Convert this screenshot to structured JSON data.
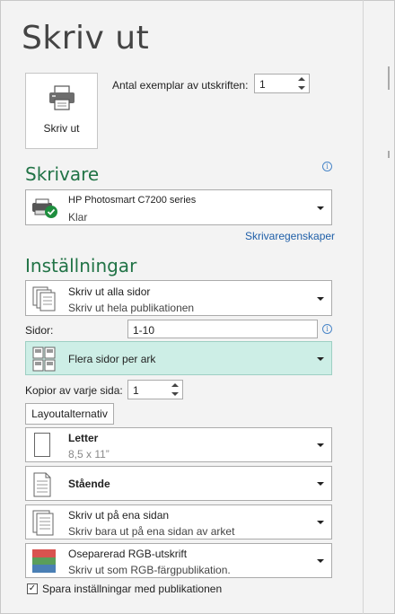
{
  "page": {
    "title": "Skriv ut"
  },
  "print_button": {
    "label": "Skriv ut"
  },
  "copies": {
    "label": "Antal exemplar av utskriften:",
    "value": "1"
  },
  "printer": {
    "heading": "Skrivare",
    "name": "HP Photosmart C7200 series",
    "status": "Klar",
    "properties_link": "Skrivaregenskaper"
  },
  "settings": {
    "heading": "Inställningar",
    "print_range": {
      "title": "Skriv ut alla sidor",
      "subtitle": "Skriv ut hela publikationen"
    },
    "pages": {
      "label": "Sidor:",
      "value": "1-10"
    },
    "layout": {
      "title": "Flera sidor per ark"
    },
    "copies_per_page": {
      "label": "Kopior av varje sida:",
      "value": "1"
    },
    "layout_options_button": "Layoutalternativ",
    "paper": {
      "title": "Letter",
      "subtitle": "8,5 x 11”"
    },
    "orientation": {
      "title": "Stående"
    },
    "sides": {
      "title": "Skriv ut på ena sidan",
      "subtitle": "Skriv bara ut på ena sidan av arket"
    },
    "color": {
      "title": "Oseparerad RGB-utskrift",
      "subtitle": "Skriv ut som RGB-färgpublikation."
    },
    "save_settings": {
      "label": "Spara inställningar med publikationen",
      "checked": true
    }
  },
  "colors": {
    "accent": "#217346",
    "selected_bg": "#cdeee6",
    "link": "#1f5fa8"
  },
  "icons": [
    "printer-icon",
    "info-icon",
    "printer-ready-icon",
    "pages-stack-icon",
    "multiple-pages-icon",
    "page-icon",
    "portrait-page-icon",
    "one-sided-icon",
    "rgb-color-icon",
    "chevron-down-icon",
    "checkmark-icon"
  ]
}
